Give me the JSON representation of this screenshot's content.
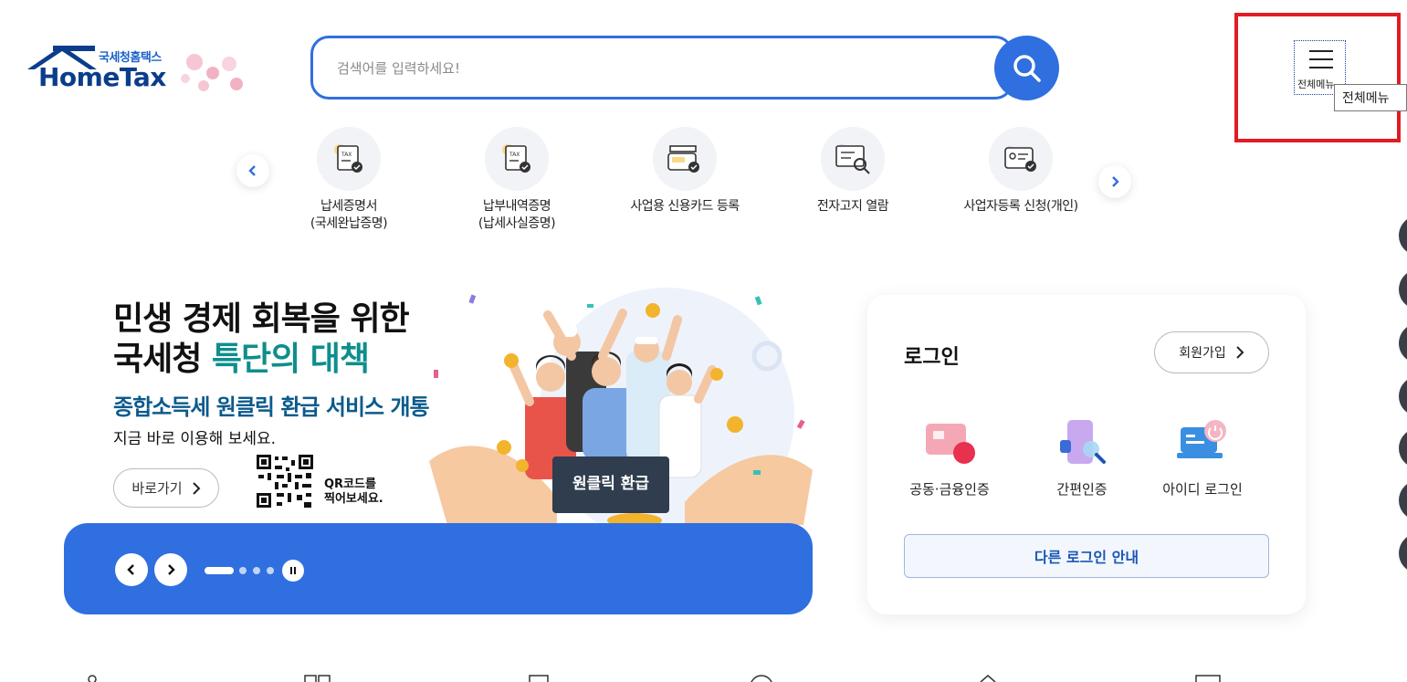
{
  "header": {
    "logo_sub": "국세청홈택스",
    "logo_main": "HomeTax",
    "search_placeholder": "검색어를 입력하세요!",
    "search_icon": "search-icon",
    "menu_label": "전체메뉴",
    "menu_tooltip": "전체메뉴",
    "colors": {
      "brand": "#2f6fe0",
      "highlight": "#e01c24"
    }
  },
  "quick_menu": {
    "items": [
      {
        "label_line1": "납세증명서",
        "label_line2": "(국세완납증명)",
        "icon": "tax-certificate-icon"
      },
      {
        "label_line1": "납부내역증명",
        "label_line2": "(납세사실증명)",
        "icon": "tax-payment-record-icon"
      },
      {
        "label_line1": "사업용 신용카드 등록",
        "label_line2": "",
        "icon": "business-card-icon"
      },
      {
        "label_line1": "전자고지 열람",
        "label_line2": "",
        "icon": "e-notice-icon"
      },
      {
        "label_line1": "사업자등록 신청(개인)",
        "label_line2": "",
        "icon": "business-registration-icon"
      }
    ]
  },
  "banner": {
    "title_line1": "민생 경제 회복을 위한",
    "title_line2_prefix": "국세청 ",
    "title_line2_highlight": "특단의 대책",
    "subtitle": "종합소득세 원클릭 환급 서비스 개통",
    "note": "지금 바로 이용해 보세요.",
    "goto_label": "바로가기",
    "qr_line1": "QR코드를",
    "qr_line2": "찍어보세요.",
    "sign_text": "원클릭 환급"
  },
  "login": {
    "title": "로그인",
    "join_label": "회원가입",
    "options": [
      {
        "label": "공동·금융인증",
        "icon": "certificate-icon"
      },
      {
        "label": "간편인증",
        "icon": "simple-auth-icon"
      },
      {
        "label": "아이디 로그인",
        "icon": "id-login-icon"
      }
    ],
    "other_login_label": "다른 로그인 안내"
  }
}
